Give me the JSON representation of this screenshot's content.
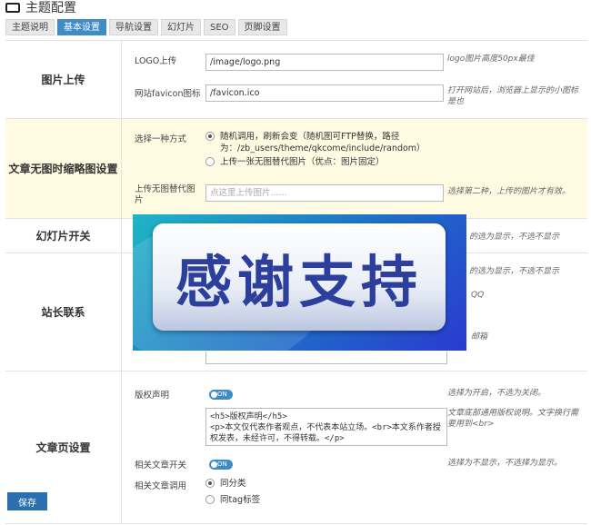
{
  "header": {
    "title": "主题配置"
  },
  "tabs": [
    "主题说明",
    "基本设置",
    "导航设置",
    "幻灯片",
    "SEO",
    "页脚设置"
  ],
  "sections": {
    "image_upload": {
      "label": "图片上传",
      "logo_label": "LOGO上传",
      "logo_value": "/image/logo.png",
      "logo_hint": "logo图片高度50px最佳",
      "favicon_label": "网站favicon图标",
      "favicon_value": "/favicon.ico",
      "favicon_hint": "打开网站后，浏览器上显示的小图标是也"
    },
    "no_thumb": {
      "label": "文章无图时缩略图设置",
      "method_label": "选择一种方式",
      "option1": "随机调用，刷新会变（随机图可FTP替换，路径为：/zb_users/theme/qkcome/include/random）",
      "option2": "上传一张无图替代图片（优点：图片固定）",
      "upload_label": "上传无图替代图片",
      "upload_placeholder": "点这里上传图片......",
      "upload_hint": "选择第二种，上传的图片才有效。"
    },
    "slider": {
      "label": "幻灯片开关",
      "hint": "的选为显示，不选不显示"
    },
    "contact": {
      "label": "站长联系",
      "hint1": "的选为显示，不选不显示",
      "hint2": "QQ",
      "hint3": "邮箱"
    },
    "article": {
      "label": "文章页设置",
      "copyright_label": "版权声明",
      "copyright_toggle": "ON",
      "copyright_hint": "选择为开启，不选为关闭。",
      "copyright_text": "<h5>版权声明</h5>\n<p>本文仅代表作者观点，不代表本站立场。<br>本文系作者授权发表，未经许可，不得转载。</p>",
      "copyright_text_hint": "文章底部通用版权说明。文字换行需要用到<br>",
      "related_switch_label": "相关文章开关",
      "related_toggle": "ON",
      "related_switch_hint": "选择为不显示，不选择为显示。",
      "related_call_label": "相关文章调用",
      "related_opt1": "同分类",
      "related_opt2": "同tag标签"
    }
  },
  "save_label": "保存",
  "overlay": {
    "text": "感谢支持"
  },
  "colors": {
    "accent": "#3d8cc6",
    "highlight_row": "#fffbe3",
    "save_button": "#2a6fb0"
  }
}
